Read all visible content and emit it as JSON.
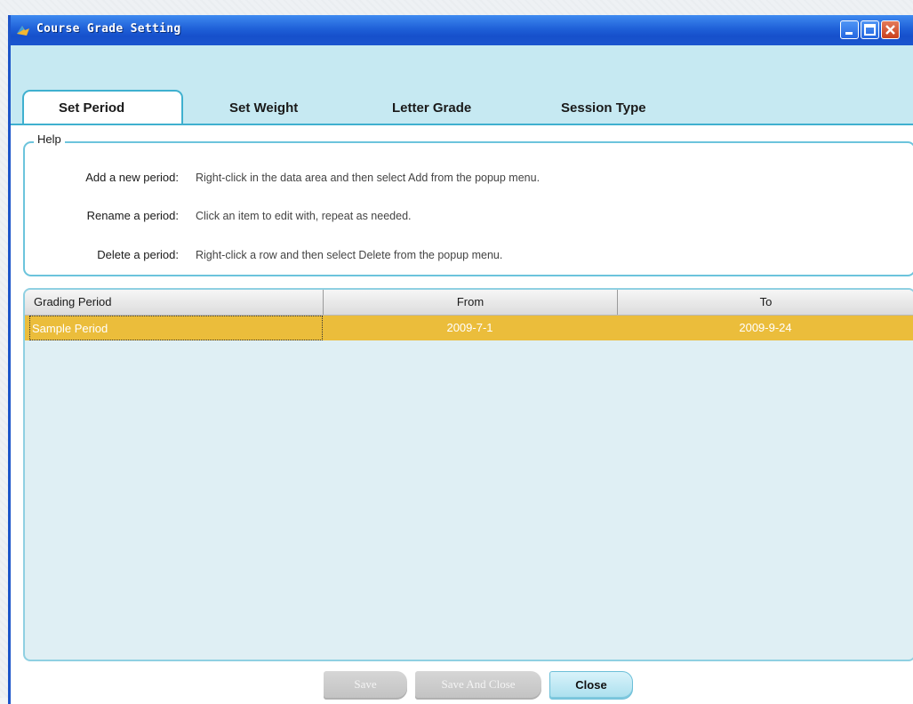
{
  "window": {
    "title": "Course Grade Setting"
  },
  "tabs": [
    {
      "label": "Set Period",
      "active": true
    },
    {
      "label": "Set Weight",
      "active": false
    },
    {
      "label": "Letter Grade",
      "active": false
    },
    {
      "label": "Session Type",
      "active": false
    }
  ],
  "help": {
    "legend": "Help",
    "items": [
      {
        "key": "Add a new period:",
        "text": "Right-click in the data area and then select Add from the popup menu."
      },
      {
        "key": "Rename a period:",
        "text": "Click an item to edit with, repeat as needed."
      },
      {
        "key": "Delete a period:",
        "text": "Right-click a row and then select Delete from the popup menu."
      }
    ]
  },
  "table": {
    "columns": [
      "Grading Period",
      "From",
      "To"
    ],
    "rows": [
      {
        "period": "Sample Period",
        "from": "2009-7-1",
        "to": "2009-9-24",
        "selected": true
      }
    ]
  },
  "buttons": {
    "save": "Save",
    "save_and_close": "Save And Close",
    "close": "Close"
  },
  "colors": {
    "title_bar": "#1f60d8",
    "tab_strip": "#c6e9f2",
    "accent": "#3fb0cf",
    "selected_row": "#ebbd3b",
    "table_background": "#dfeff4"
  }
}
